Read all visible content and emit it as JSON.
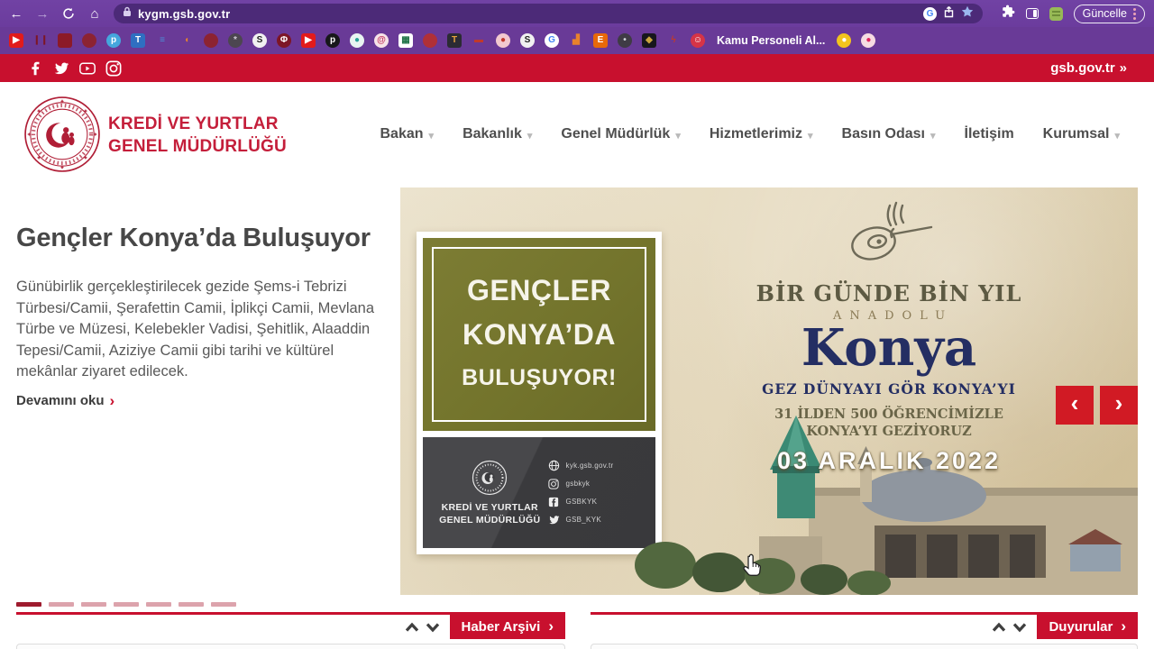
{
  "colors": {
    "accent_red": "#c8102e",
    "browser_purple": "#6b3c9d",
    "urlbar_purple": "#4c2a78",
    "navy": "#242e63",
    "olive": "#73742c"
  },
  "browser": {
    "url": "kygm.gsb.gov.tr",
    "update_button": "Güncelle",
    "icons": [
      {
        "name": "youtube",
        "shape": "sq",
        "bg": "#e21b1b",
        "fg": "#ffffff",
        "g": "▶"
      },
      {
        "name": "pause-maroon",
        "shape": "sq",
        "bg": "none",
        "fg": "#7d1626",
        "g": "❙❙"
      },
      {
        "name": "red-square",
        "shape": "sq",
        "bg": "#8c1a28",
        "fg": "#8c1a28",
        "g": ""
      },
      {
        "name": "maroon-circle",
        "shape": "c",
        "bg": "#8c2332",
        "fg": "#8c2332",
        "g": ""
      },
      {
        "name": "p-blue",
        "shape": "c",
        "bg": "#45a7dd",
        "fg": "#ffffff",
        "g": "p"
      },
      {
        "name": "t-blue",
        "shape": "sq",
        "bg": "#2f6fc1",
        "fg": "#ffffff",
        "g": "T"
      },
      {
        "name": "lines-blue",
        "shape": "sq",
        "bg": "none",
        "fg": "#4a90d9",
        "g": "≡"
      },
      {
        "name": "crescent-orange",
        "shape": "c",
        "bg": "none",
        "fg": "#e8822c",
        "g": "◖"
      },
      {
        "name": "maroon-circle-2",
        "shape": "c",
        "bg": "#8c2332",
        "fg": "#8c2332",
        "g": ""
      },
      {
        "name": "dark-emblem",
        "shape": "c",
        "bg": "#4c4650",
        "fg": "#cfc9d4",
        "g": "*"
      },
      {
        "name": "s-white",
        "shape": "c",
        "bg": "#f1f1f1",
        "fg": "#222222",
        "g": "S"
      },
      {
        "name": "phi-maroon",
        "shape": "c",
        "bg": "#7d1626",
        "fg": "#ffffff",
        "g": "Φ"
      },
      {
        "name": "youtube-2",
        "shape": "sq",
        "bg": "#e21b1b",
        "fg": "#ffffff",
        "g": "▶"
      },
      {
        "name": "p-black",
        "shape": "c",
        "bg": "#17171a",
        "fg": "#ffffff",
        "g": "p"
      },
      {
        "name": "drop-teal",
        "shape": "c",
        "bg": "#e9f4f1",
        "fg": "#2aa198",
        "g": "●"
      },
      {
        "name": "at-pink",
        "shape": "c",
        "bg": "#f6e3e8",
        "fg": "#c2375e",
        "g": "@"
      },
      {
        "name": "sheet-green",
        "shape": "sq",
        "bg": "#ffffff",
        "fg": "#1e7145",
        "g": "▦"
      },
      {
        "name": "red-blob",
        "shape": "c",
        "bg": "#b03037",
        "fg": "#b03037",
        "g": ""
      },
      {
        "name": "shield-dark",
        "shape": "sq",
        "bg": "#2b2b33",
        "fg": "#e8a33d",
        "g": "T"
      },
      {
        "name": "red-dash",
        "shape": "sq",
        "bg": "none",
        "fg": "#c0392b",
        "g": "▬"
      },
      {
        "name": "dot-pink",
        "shape": "c",
        "bg": "#f2c9cf",
        "fg": "#c0392b",
        "g": "●"
      },
      {
        "name": "s-white-2",
        "shape": "c",
        "bg": "#f1f1f1",
        "fg": "#222222",
        "g": "S"
      },
      {
        "name": "google",
        "shape": "c",
        "bg": "#ffffff",
        "fg": "#4285f4",
        "g": "G"
      },
      {
        "name": "chart-orange",
        "shape": "sq",
        "bg": "none",
        "fg": "#e8822c",
        "g": "▟"
      },
      {
        "name": "e-orange",
        "shape": "sq",
        "bg": "#e8690a",
        "fg": "#ffffff",
        "g": "E"
      },
      {
        "name": "dark-dot",
        "shape": "c",
        "bg": "#3f3b45",
        "fg": "#cfd3d8",
        "g": "•"
      },
      {
        "name": "black-badge",
        "shape": "sq",
        "bg": "#17171c",
        "fg": "#caa53d",
        "g": "◆"
      },
      {
        "name": "red-bolt",
        "shape": "sq",
        "bg": "none",
        "fg": "#c0392b",
        "g": "ϟ"
      },
      {
        "name": "kamu-personeli",
        "shape": "c",
        "bg": "#d63447",
        "fg": "#ffffff",
        "g": "☺",
        "label": "Kamu Personeli Al..."
      },
      {
        "name": "bell-yellow",
        "shape": "c",
        "bg": "#f2c41d",
        "fg": "#ffffff",
        "g": "●"
      },
      {
        "name": "pink-red",
        "shape": "c",
        "bg": "#f6dce2",
        "fg": "#e0245e",
        "g": "●"
      }
    ]
  },
  "socialbar": {
    "portal_link": "gsb.gov.tr",
    "portal_arrows": "»"
  },
  "header": {
    "org_line1": "KREDİ VE YURTLAR",
    "org_line2": "GENEL MÜDÜRLÜĞÜ",
    "nav": [
      {
        "key": "bakan",
        "label": "Bakan",
        "dropdown": true
      },
      {
        "key": "bakanlik",
        "label": "Bakanlık",
        "dropdown": true
      },
      {
        "key": "genel-mudurluk",
        "label": "Genel Müdürlük",
        "dropdown": true
      },
      {
        "key": "hizmetlerimiz",
        "label": "Hizmetlerimiz",
        "dropdown": true
      },
      {
        "key": "basin-odasi",
        "label": "Basın Odası",
        "dropdown": true
      },
      {
        "key": "iletisim",
        "label": "İletişim",
        "dropdown": false
      },
      {
        "key": "kurumsal",
        "label": "Kurumsal",
        "dropdown": true
      }
    ]
  },
  "article": {
    "title": "Gençler Konya’da Buluşuyor",
    "body": "Günübirlik gerçekleştirilecek gezide Şems-i Tebrizi Türbesi/Camii, Şerafettin Camii, İplikçi Camii, Mevlana Türbe ve Müzesi, Kelebekler Vadisi, Şehitlik, Alaaddin Tepesi/Camii, Aziziye Camii gibi tarihi ve kültürel mekânlar ziyaret edilecek.",
    "read_more": "Devamını oku",
    "read_more_chevron": "›"
  },
  "carousel": {
    "poster": {
      "badge_line1": "GENÇLER",
      "badge_line2": "KONYA’DA",
      "badge_line3": "BULUŞUYOR!",
      "org_line1": "KREDİ VE YURTLAR",
      "org_line2": "GENEL MÜDÜRLÜĞÜ",
      "contacts": [
        {
          "icon": "globe",
          "handle": "kyk.gsb.gov.tr"
        },
        {
          "icon": "instagram",
          "handle": "gsbkyk"
        },
        {
          "icon": "facebook",
          "handle": "GSBKYK"
        },
        {
          "icon": "twitter",
          "handle": "GSB_KYK"
        }
      ],
      "title_top": "BİR GÜNDE BİN YIL",
      "title_sub": "ANADOLU",
      "title_main": "Konya",
      "tagline": "GEZ DÜNYAYI GÖR KONYA’YI",
      "info_line1": "31 İLDEN 500 ÖĞRENCİMİZLE",
      "info_line2": "KONYA’YI GEZİYORUZ",
      "date": "03 ARALIK 2022"
    },
    "prev": "‹",
    "next": "›",
    "dots": {
      "count": 7,
      "active": 0
    }
  },
  "sections": {
    "left_button": "Haber Arşivi",
    "right_button": "Duyurular",
    "button_chevron": "›"
  }
}
